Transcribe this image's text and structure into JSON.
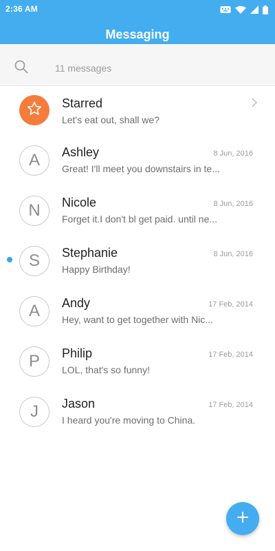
{
  "status_bar": {
    "time": "2:36 AM"
  },
  "header": {
    "title": "Messaging"
  },
  "search": {
    "count_text": "11 messages"
  },
  "conversations": [
    {
      "name": "Starred",
      "preview": "Let's eat out, shall we?",
      "date": "",
      "avatar": "star-icon",
      "unread": false,
      "has_chevron": true
    },
    {
      "name": "Ashley",
      "preview": "Great! I'll meet you downstairs in te...",
      "date": "8 Jun, 2016",
      "avatar": "A",
      "unread": false
    },
    {
      "name": "Nicole",
      "preview": "Forget it.I don't bl get paid. until ne...",
      "date": "8 Jun, 2016",
      "avatar": "N",
      "unread": false
    },
    {
      "name": "Stephanie",
      "preview": "Happy Birthday!",
      "date": "8 Jun, 2016",
      "avatar": "S",
      "unread": true
    },
    {
      "name": "Andy",
      "preview": "Hey, want to get together with Nic...",
      "date": "17 Feb, 2014",
      "avatar": "A",
      "unread": false
    },
    {
      "name": "Philip",
      "preview": "LOL, that's so funny!",
      "date": "17 Feb, 2014",
      "avatar": "P",
      "unread": false
    },
    {
      "name": "Jason",
      "preview": "I heard you're moving to China.",
      "date": "17 Feb, 2014",
      "avatar": "J",
      "unread": false
    }
  ],
  "fab": {
    "icon": "plus-icon"
  },
  "colors": {
    "accent": "#43adf0",
    "starred_avatar": "#f57c3c",
    "unread_dot": "#3aa3ee"
  }
}
